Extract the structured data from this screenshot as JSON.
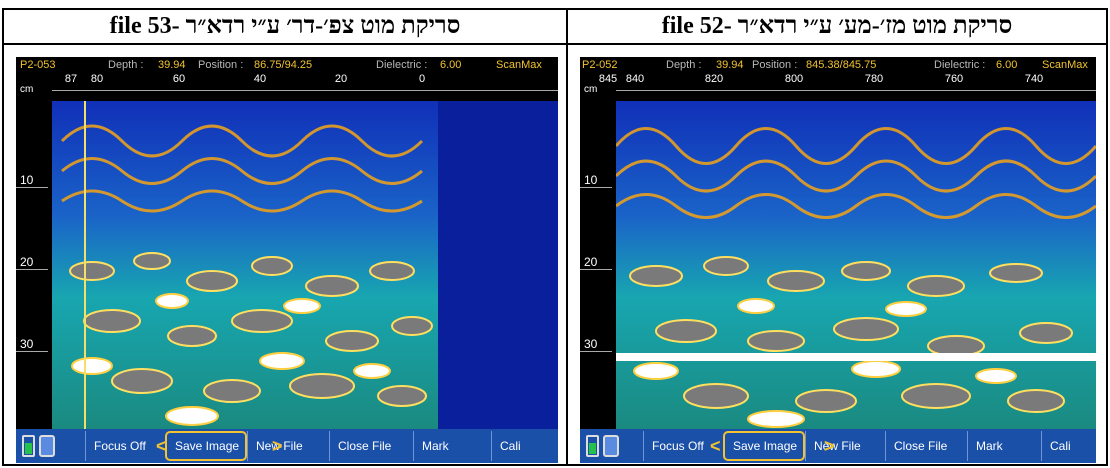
{
  "panels": [
    {
      "caption": "סריקת מוט צפ׳-דר׳ ע״י רדא״ר -53 file",
      "file_id": "P2-053",
      "depth_label": "Depth :",
      "depth_value": "39.94",
      "position_label": "Position :",
      "position_value": "86.75/94.25",
      "dielectric_label": "Dielectric :",
      "dielectric_value": "6.00",
      "brand": "ScanMax",
      "unit": "cm",
      "ruler_labels": [
        "87",
        "80",
        "60",
        "40",
        "20",
        "0"
      ],
      "depth_labels": [
        "10",
        "20",
        "30"
      ],
      "toolbar": [
        "Focus Off",
        "Save Image",
        "New File",
        "Close File",
        "Mark",
        "Cali"
      ]
    },
    {
      "caption": "סריקת מוט מז׳-מע׳ ע״י רדא״ר -52 file",
      "file_id": "P2-052",
      "depth_label": "Depth :",
      "depth_value": "39.94",
      "position_label": "Position :",
      "position_value": "845.38/845.75",
      "dielectric_label": "Dielectric :",
      "dielectric_value": "6.00",
      "brand": "ScanMax",
      "unit": "cm",
      "ruler_labels": [
        "845",
        "840",
        "820",
        "800",
        "780",
        "760",
        "740"
      ],
      "depth_labels": [
        "10",
        "20",
        "30"
      ],
      "toolbar": [
        "Focus Off",
        "Save Image",
        "New File",
        "Close File",
        "Mark",
        "Cali"
      ]
    }
  ],
  "colors": {
    "toolbar_bg": "#1a50a8",
    "highlight": "#f2c230",
    "scan_bg": "#0a1f9c"
  }
}
